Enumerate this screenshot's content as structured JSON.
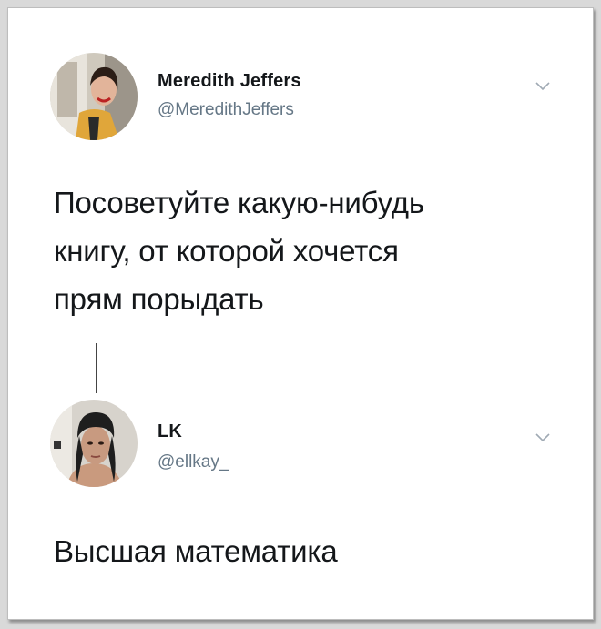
{
  "tweets": [
    {
      "name": "Meredith Jeffers",
      "handle": "@MeredithJeffers",
      "text_lines": [
        "Посоветуйте какую-нибудь",
        "книгу, от которой хочется",
        "прям порыдать"
      ]
    },
    {
      "name": "LK",
      "handle": "@ellkay_",
      "text_lines": [
        "Высшая математика"
      ]
    }
  ],
  "icons": {
    "menu": "chevron-down-icon",
    "thread": "thread-connector-line"
  },
  "colors": {
    "background": "#ffffff",
    "text": "#14171a",
    "handle": "#657786",
    "chevron": "#a0aab4"
  }
}
